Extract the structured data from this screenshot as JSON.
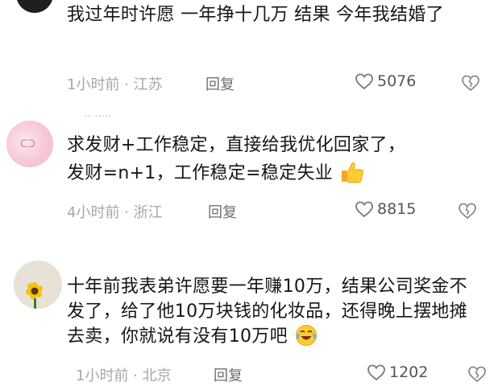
{
  "comments": [
    {
      "text": "我过年时许愿 一年挣十几万 结果 今年我结婚了",
      "time": "1小时前",
      "location": "江苏",
      "reply_label": "回复",
      "likes": "5076"
    },
    {
      "text_line1": "求发财+工作稳定，直接给我优化回家了，",
      "text_line2": "发财=n+1，工作稳定=稳定失业",
      "time": "4小时前",
      "location": "浙江",
      "reply_label": "回复",
      "likes": "8815"
    },
    {
      "text": "十年前我表弟许愿要一年赚10万，结果公司奖金不发了，给了他10万块钱的化妆品，还得晚上摆地摊去卖，你就说有没有10万吧",
      "time": "1小时前",
      "location": "北京",
      "reply_label": "回复",
      "likes": "1202"
    }
  ],
  "icons": {
    "like": "heart-outline-icon",
    "dislike": "broken-heart-icon",
    "emoji_2": "thumbs-up-emoji",
    "emoji_3": "crying-laughing-emoji"
  }
}
